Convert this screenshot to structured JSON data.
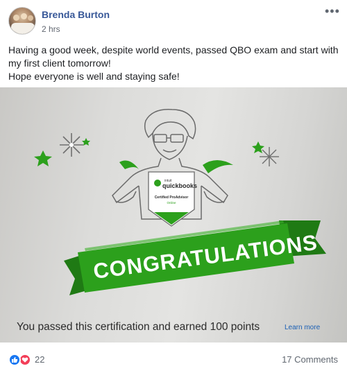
{
  "post": {
    "author": "Brenda Burton",
    "timestamp": "2 hrs",
    "more_icon": "more-horizontal-icon",
    "text_lines": [
      "Having a good week, despite world events, passed QBO exam and start with my first client tomorrow!",
      "Hope everyone is well and staying safe!"
    ]
  },
  "photo": {
    "shirt_brand_small": "intuit",
    "shirt_brand": "quickbooks",
    "shirt_line1": "Certified ProAdvisor",
    "shirt_line2": "Online",
    "banner_text": "CONGRATULATIONS",
    "message": "You passed this certification and earned 100 points",
    "learn_more": "Learn more",
    "colors": {
      "green": "#2ca01c",
      "dark_green": "#1f7a14",
      "outline": "#6a6a6a"
    }
  },
  "footer": {
    "reactions": [
      "like-icon",
      "love-icon"
    ],
    "reaction_count": "22",
    "comments": "17 Comments"
  }
}
